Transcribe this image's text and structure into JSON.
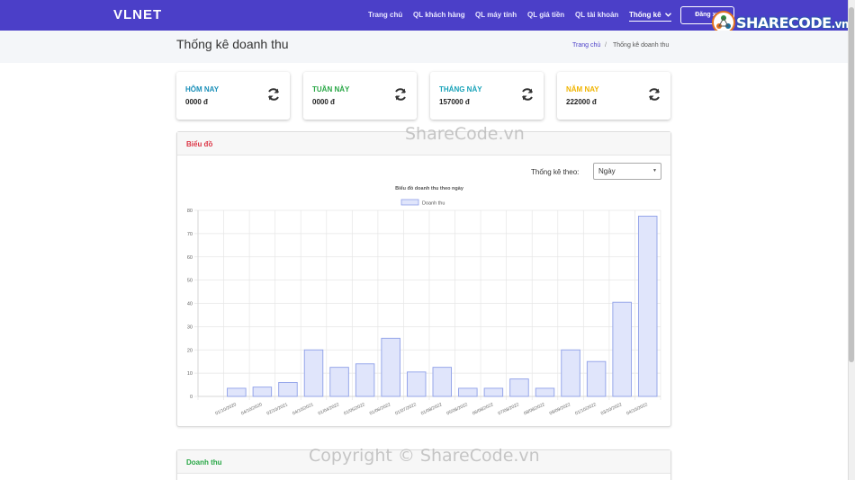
{
  "navbar": {
    "brand": "VLNET",
    "items": [
      "Trang chủ",
      "QL khách hàng",
      "QL máy tính",
      "QL giá tiền",
      "QL tài khoản",
      "Thống kê"
    ],
    "logout_label": "Đăng xuất",
    "logout_visible": "Đăng xu"
  },
  "watermark_logo": {
    "main": "SHARECODE",
    "suffix": ".vn"
  },
  "header": {
    "title": "Thống kê doanh thu",
    "breadcrumb_home": "Trang chủ",
    "breadcrumb_sep": "/",
    "breadcrumb_current": "Thống kê doanh thu"
  },
  "cards": [
    {
      "label": "HÔM NAY",
      "value": "0000 đ",
      "color": "#1a8fb8"
    },
    {
      "label": "TUẦN NÀY",
      "value": "0000 đ",
      "color": "#28a745"
    },
    {
      "label": "THÁNG NÀY",
      "value": "157000 đ",
      "color": "#17a2b8"
    },
    {
      "label": "NĂM NAY",
      "value": "222000 đ",
      "color": "#f0b400"
    }
  ],
  "chart_panel": {
    "title": "Biểu đồ",
    "title_color": "#dc3545",
    "filter_label": "Thống kê theo:",
    "filter_value": "Ngày"
  },
  "revenue_panel": {
    "title": "Doanh thu",
    "title_color": "#28a745"
  },
  "watermarks": [
    "ShareCode.vn",
    "Copyright © ShareCode.vn"
  ],
  "chart_data": {
    "type": "bar",
    "title": "Biểu đồ doanh thu theo ngày",
    "legend_position": "top",
    "grid": true,
    "ylim": [
      0,
      80
    ],
    "yticks": [
      0,
      10,
      20,
      30,
      40,
      50,
      60,
      70,
      80
    ],
    "categories": [
      "01/10/2020",
      "04/10/2020",
      "02/10/2021",
      "04/10/2021",
      "01/04/2022",
      "01/05/2022",
      "01/06/2022",
      "01/07/2022",
      "01/08/2022",
      "05/08/2022",
      "06/08/2022",
      "07/08/2022",
      "08/08/2022",
      "09/09/2022",
      "01/10/2022",
      "03/10/2022",
      "04/10/2022"
    ],
    "series": [
      {
        "name": "Doanh thu",
        "fill": "#e0e5fb",
        "stroke": "#8e9fe8",
        "values": [
          null,
          3.5,
          4,
          6,
          20,
          12.5,
          14,
          25,
          10.5,
          12.5,
          3.5,
          3.5,
          7.5,
          3.5,
          20,
          15,
          40.5,
          77.5
        ]
      }
    ]
  }
}
